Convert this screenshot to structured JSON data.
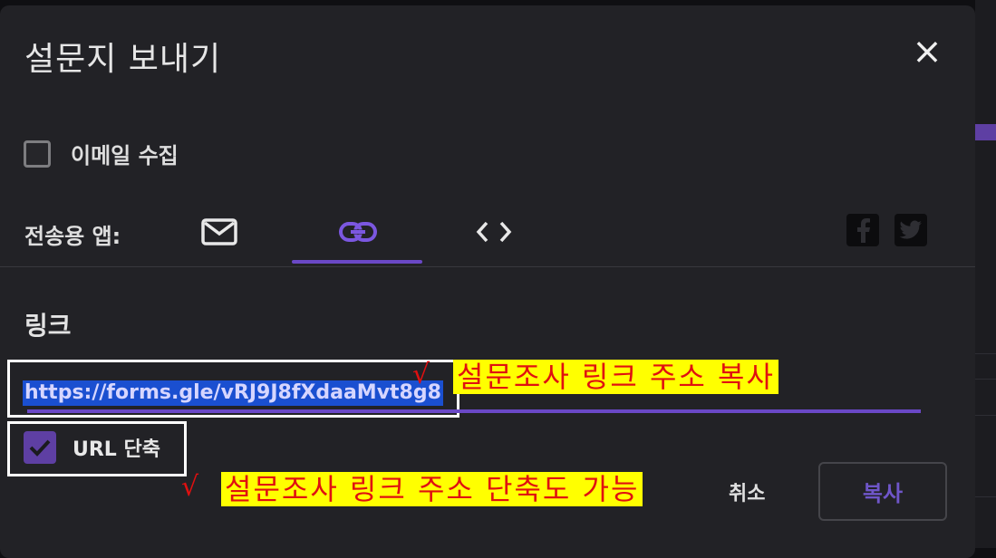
{
  "dialog": {
    "title": "설문지 보내기",
    "close_icon": "close-icon"
  },
  "email": {
    "label": "이메일 수집",
    "checked": false
  },
  "send_via": {
    "label": "전송용 앱:",
    "tabs": [
      {
        "name": "email",
        "icon": "envelope-icon",
        "selected": false
      },
      {
        "name": "link",
        "icon": "link-icon",
        "selected": true
      },
      {
        "name": "embed",
        "icon": "code-icon",
        "selected": false
      }
    ],
    "social": [
      {
        "name": "facebook",
        "icon": "facebook-icon"
      },
      {
        "name": "twitter",
        "icon": "twitter-icon"
      }
    ]
  },
  "link_section": {
    "heading": "링크",
    "url": "https://forms.gle/vRJ9J8fXdaaMvt8g8",
    "shorten_label": "URL 단축",
    "shorten_checked": true
  },
  "annotations": {
    "copy_note": "설문조사 링크 주소 복사",
    "shorten_note": "설문조사 링크 주소 단축도 가능",
    "checkmark": "√"
  },
  "actions": {
    "cancel_label": "취소",
    "copy_label": "복사"
  },
  "colors": {
    "accent": "#6a48c6",
    "annotation_bg": "#ffff00",
    "annotation_text": "#e01010",
    "dialog_bg": "#222226"
  }
}
